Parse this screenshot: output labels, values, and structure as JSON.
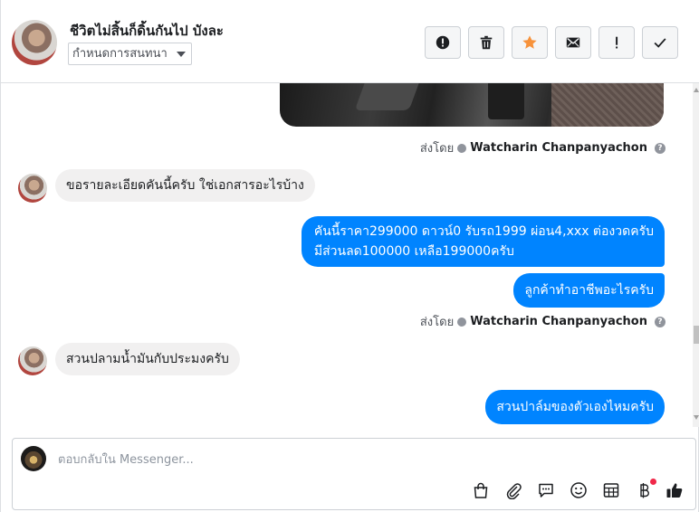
{
  "header": {
    "contact_name": "ชีวิตไม่สิ้นก็ดิ้นกันไป บังละ",
    "tag_dropdown_value": "กำหนดการสนทนา",
    "toolbar": [
      {
        "icon": "alert-circle-icon",
        "label": "mark spam"
      },
      {
        "icon": "trash-icon",
        "label": "delete"
      },
      {
        "icon": "star-icon",
        "label": "star"
      },
      {
        "icon": "envelope-icon",
        "label": "mark unread"
      },
      {
        "icon": "exclamation-icon",
        "label": "mark important"
      },
      {
        "icon": "checkmark-icon",
        "label": "mark done"
      }
    ]
  },
  "colors": {
    "accent_blue": "#0084ff",
    "incoming_bubble": "#f1f0f0",
    "star_orange": "#f7923b",
    "notification_red": "#f02849"
  },
  "messages": {
    "sent_by_label": "ส่งโดย",
    "sender_name": "Watcharin Chanpanyachon",
    "help_glyph": "?",
    "incoming_1": "ขอรายละเอียดคันนี้ครับ ใช่เอกสารอะไรบ้าง",
    "outgoing_1_line1": "คันนี้ราคา299000 ดาวน์0   รับรถ1999 ผ่อน4,xxx ต่องวดครับ",
    "outgoing_1_line2": "มีส่วนลด100000 เหลือ199000ครับ",
    "outgoing_2": "ลูกค้าทำอาชีพอะไรครับ",
    "incoming_2": "สวนปลามน้ำมันกับประมงครับ",
    "outgoing_3": "สวนปาล์มของตัวเองไหมครับ"
  },
  "composer": {
    "placeholder": "ตอบกลับใน Messenger...",
    "value": "",
    "tools": [
      "shopping-bag-icon",
      "paperclip-icon",
      "saved-replies-icon",
      "emoji-icon",
      "table-icon",
      "baht-icon",
      "thumbs-up-icon"
    ]
  }
}
